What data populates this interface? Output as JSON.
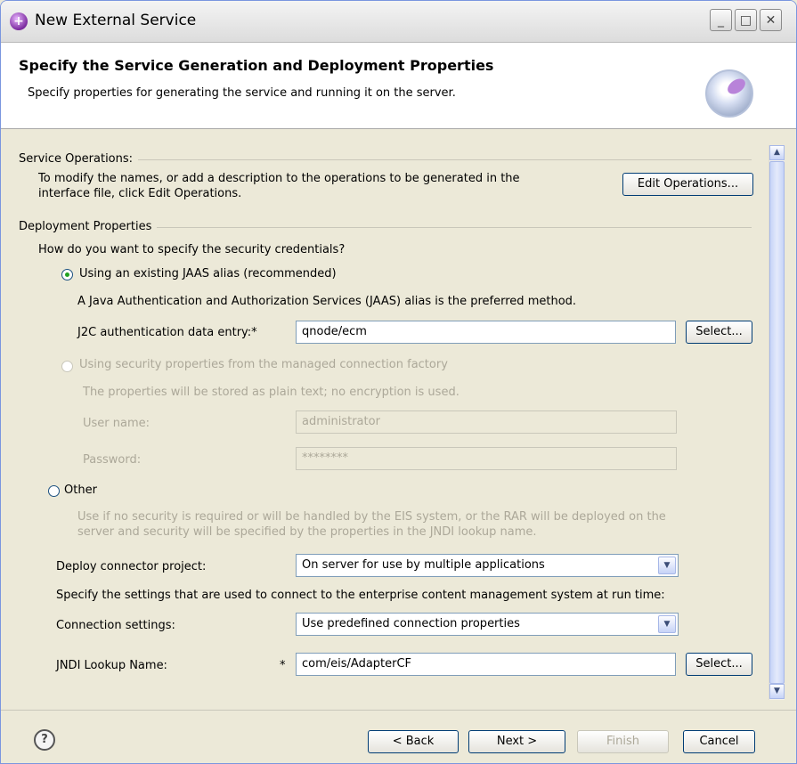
{
  "window": {
    "title": "New External Service"
  },
  "header": {
    "title": "Specify the Service Generation and Deployment Properties",
    "description": "Specify properties for generating the service and running it on the server."
  },
  "service_operations": {
    "section_label": "Service Operations:",
    "text_line1": "To modify the names, or add a description to the operations to be generated in the",
    "text_line2": "interface file, click Edit Operations.",
    "edit_button": "Edit Operations..."
  },
  "deployment": {
    "section_label": "Deployment Properties",
    "question": "How do you want to specify the security credentials?",
    "option_jaas": {
      "label": "Using an existing JAAS alias (recommended)",
      "selected": true,
      "description": "A Java Authentication and Authorization Services (JAAS) alias is the preferred method.",
      "j2c_label": "J2C authentication data entry:",
      "j2c_value": "qnode/ecm",
      "select_button": "Select..."
    },
    "option_mcf": {
      "label": "Using security properties from the managed connection factory",
      "selected": false,
      "description": "The properties will be stored as plain text; no encryption is used.",
      "user_label": "User name:",
      "user_value": "administrator",
      "password_label": "Password:",
      "password_value": "********"
    },
    "option_other": {
      "label": "Other",
      "selected": false,
      "description_line1": "Use if no security is required or will be handled by the EIS system, or the RAR will be deployed on the",
      "description_line2": "server and security will be specified by the properties in the JNDI lookup name."
    },
    "deploy_connector_label": "Deploy connector project:",
    "deploy_connector_value": "On server for use by multiple applications",
    "settings_text": "Specify the settings that are used to connect to the enterprise content management system at run time:",
    "connection_settings_label": "Connection settings:",
    "connection_settings_value": "Use predefined connection properties",
    "jndi_label": "JNDI Lookup Name:",
    "jndi_value": "com/eis/AdapterCF",
    "jndi_select_button": "Select...",
    "required_marker": "*"
  },
  "footer": {
    "back": "< Back",
    "next": "Next >",
    "finish": "Finish",
    "cancel": "Cancel"
  },
  "icons": {
    "help": "help-icon",
    "app": "app-icon",
    "wizard": "wizard-banner-icon"
  }
}
